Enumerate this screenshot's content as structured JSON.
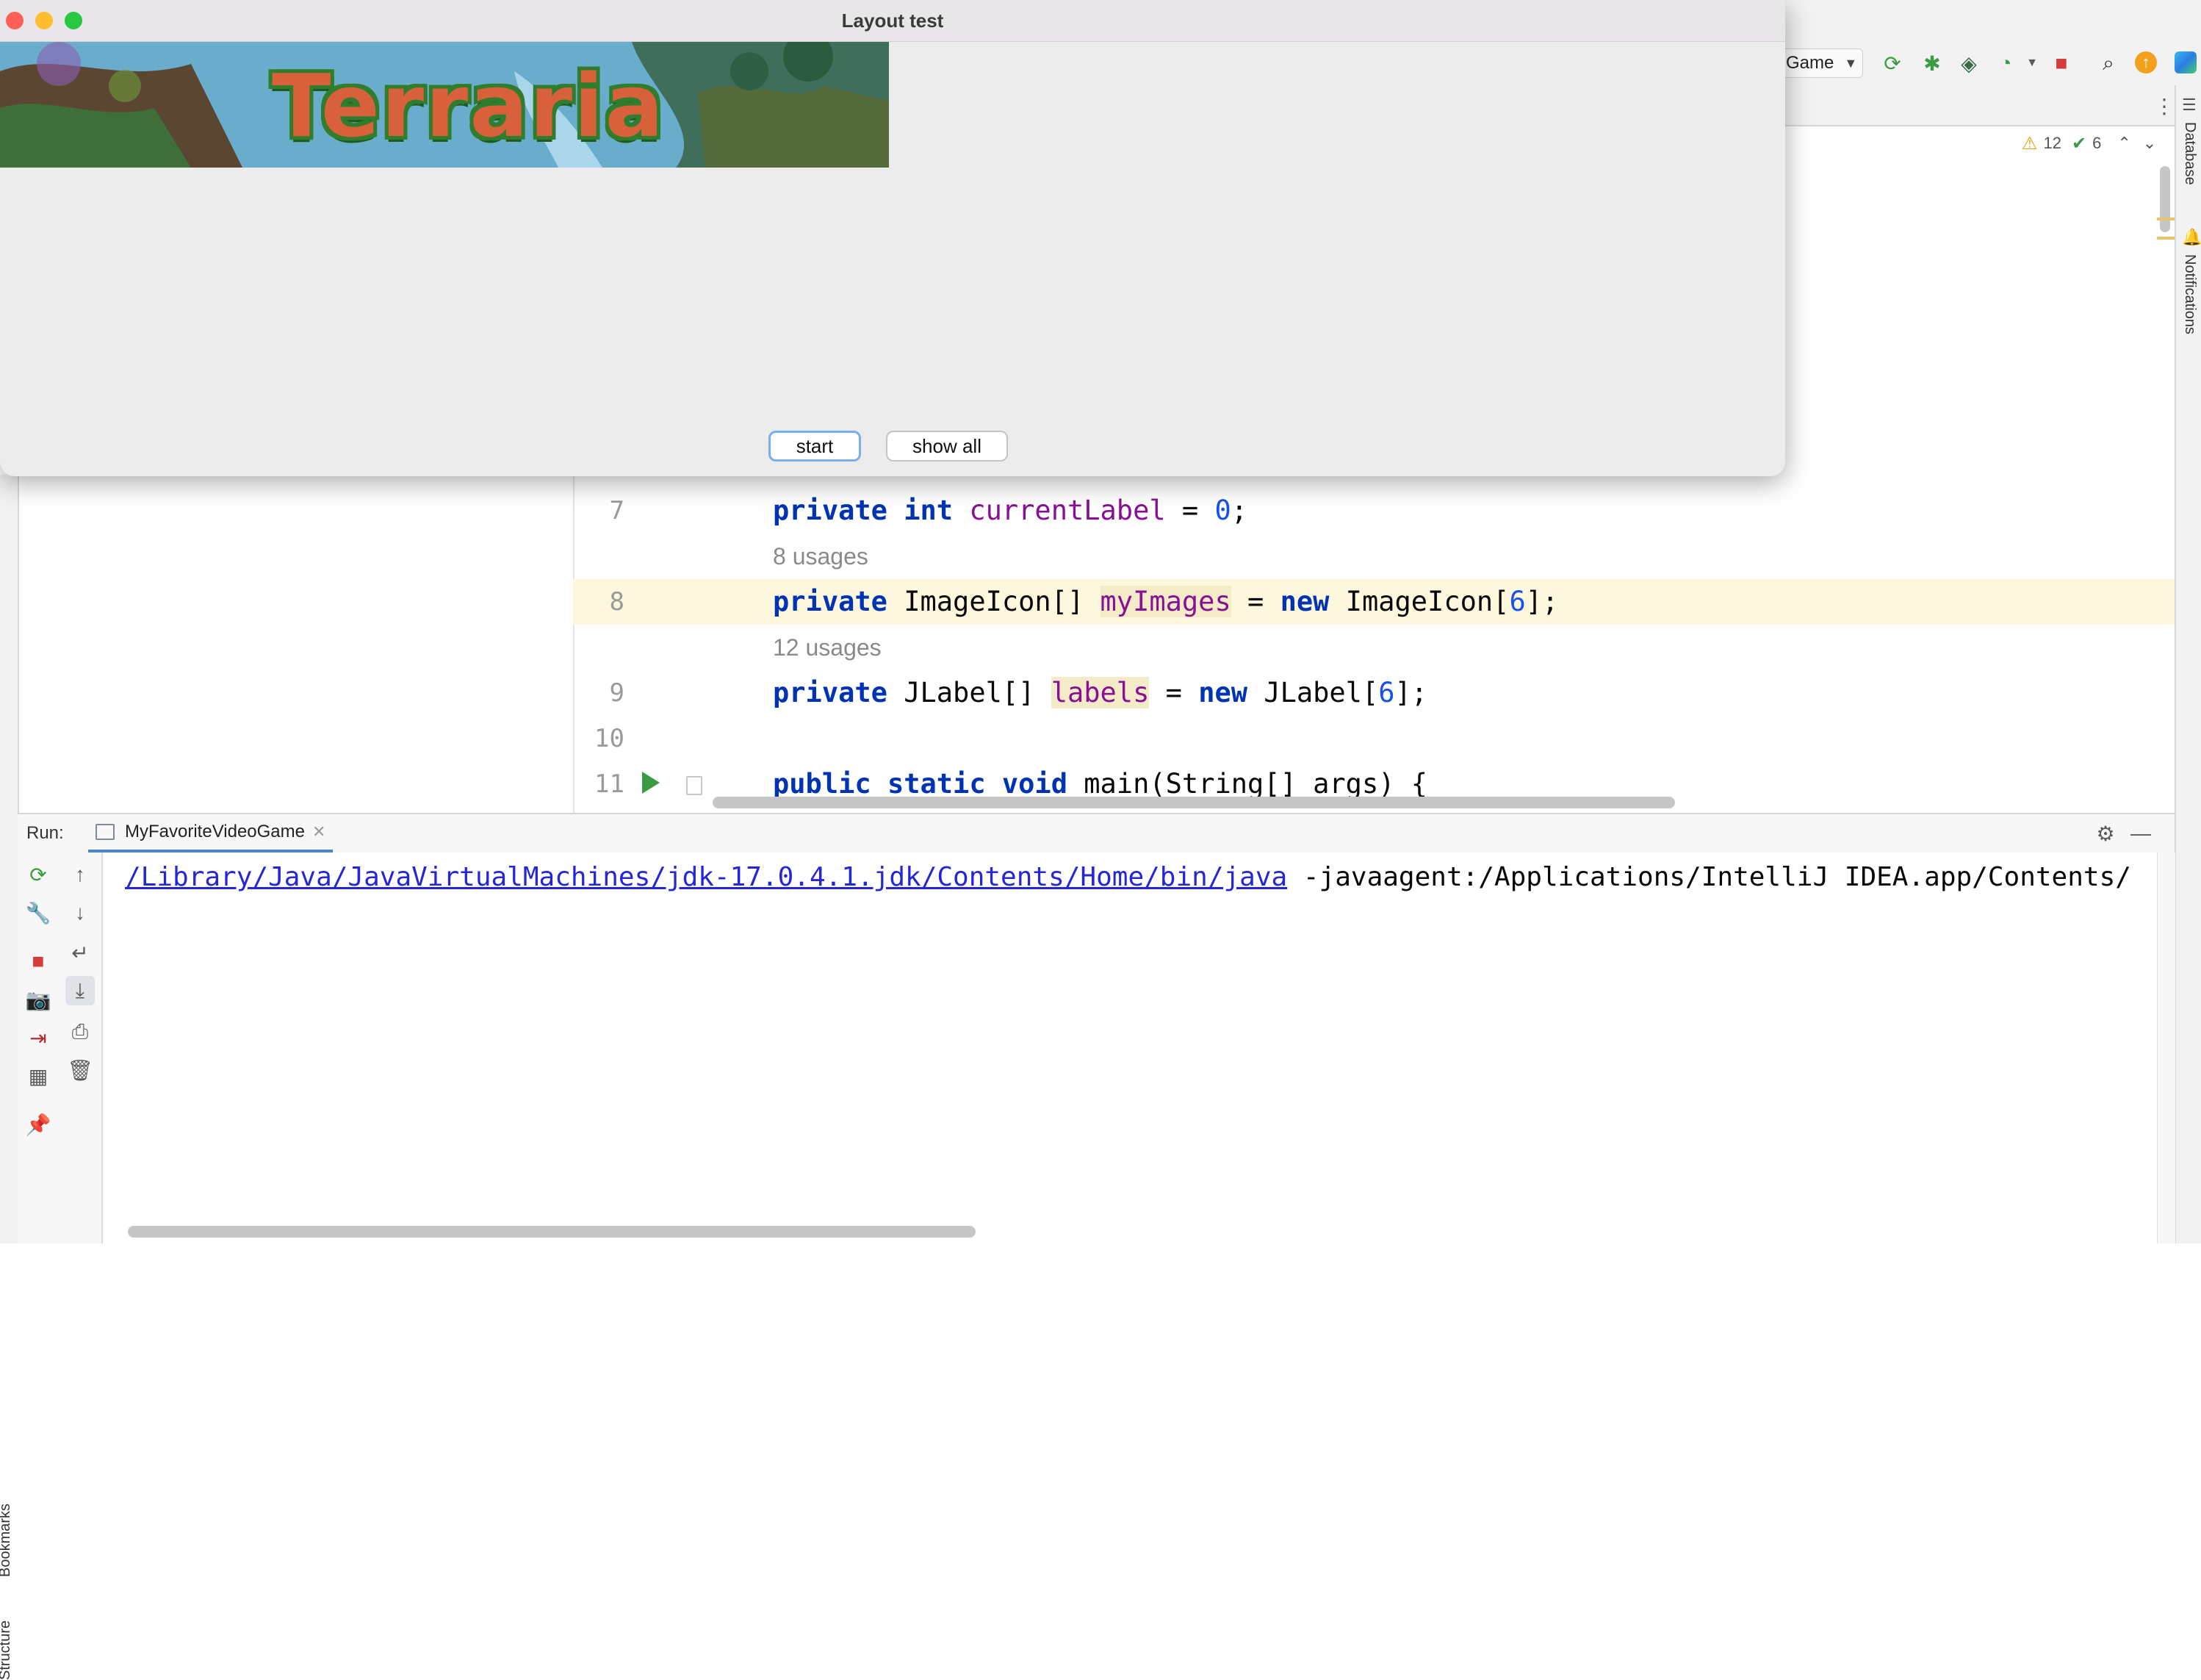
{
  "app_window": {
    "title": "Layout test",
    "banner_text": "Terraria",
    "buttons": {
      "start": "start",
      "show_all": "show all"
    }
  },
  "ide": {
    "run_config": "Game",
    "warnings_count": "12",
    "checks_count": "6",
    "right_tool_windows": [
      "Database",
      "Notifications"
    ],
    "left_tool_windows": [
      "Bookmarks",
      "Structure"
    ],
    "editor": {
      "lines": [
        {
          "number": "7",
          "usage_above": "",
          "code": "private int currentLabel = 0;"
        },
        {
          "number": "8",
          "usage_above": "8 usages",
          "code": "private ImageIcon[] myImages = new ImageIcon[6];"
        },
        {
          "number": "9",
          "usage_above": "12 usages",
          "code": "private JLabel[] labels = new JLabel[6];"
        },
        {
          "number": "10",
          "usage_above": "",
          "code": ""
        },
        {
          "number": "11",
          "usage_above": "",
          "code": "public static void main(String[] args) {"
        }
      ]
    },
    "run_panel": {
      "label": "Run:",
      "tab_name": "MyFavoriteVideoGame",
      "console_link": "/Library/Java/JavaVirtualMachines/jdk-17.0.4.1.jdk/Contents/Home/bin/java",
      "console_rest": " -javaagent:/Applications/IntelliJ IDEA.app/Contents/"
    }
  },
  "colors": {
    "keyword": "#0033b3",
    "field": "#871094",
    "number": "#1750eb",
    "link": "#2526d8",
    "close_light": "#fe5f57",
    "minimize_light": "#febc2e",
    "zoom_light": "#28c840"
  }
}
